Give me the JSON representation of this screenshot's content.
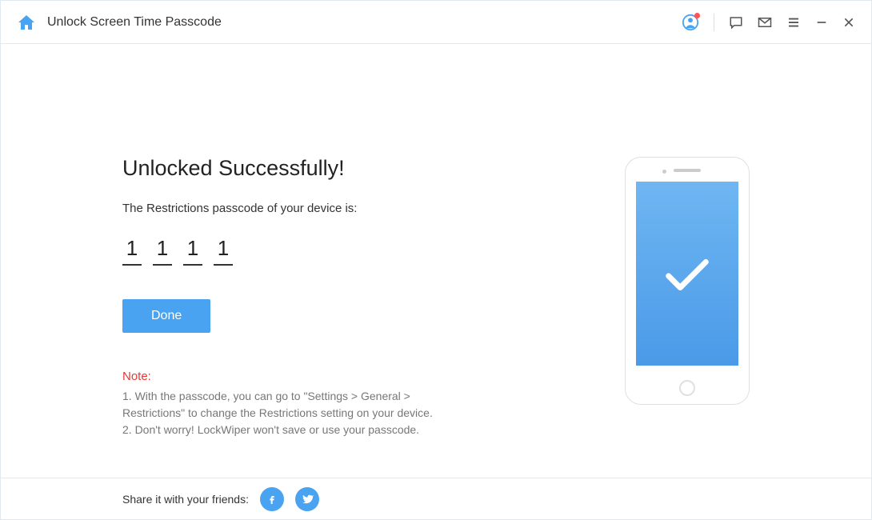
{
  "header": {
    "title": "Unlock Screen Time Passcode"
  },
  "main": {
    "headline": "Unlocked Successfully!",
    "subtext": "The Restrictions passcode of your device is:",
    "passcode": [
      "1",
      "1",
      "1",
      "1"
    ],
    "done_label": "Done",
    "note_label": "Note:",
    "notes": [
      "1. With the passcode, you can go to \"Settings > General > Restrictions\" to change the Restrictions setting on your device.",
      "2. Don't worry! LockWiper won't save or use your passcode."
    ]
  },
  "footer": {
    "share_text": "Share it with your friends:"
  }
}
